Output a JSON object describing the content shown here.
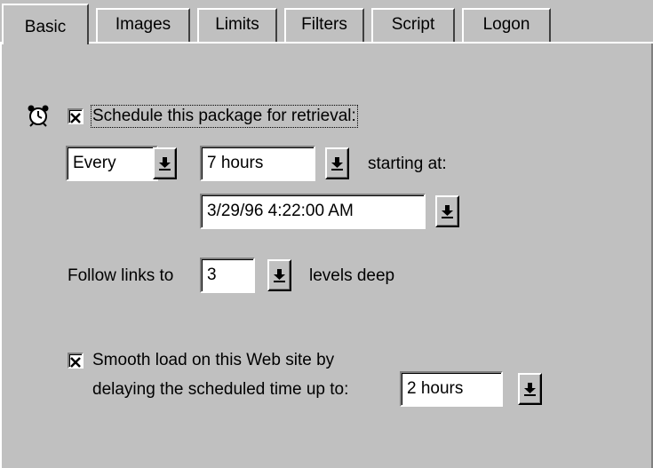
{
  "tabs": [
    {
      "label": "Basic",
      "active": true
    },
    {
      "label": "Images",
      "active": false
    },
    {
      "label": "Limits",
      "active": false
    },
    {
      "label": "Filters",
      "active": false
    },
    {
      "label": "Script",
      "active": false
    },
    {
      "label": "Logon",
      "active": false
    }
  ],
  "schedule": {
    "icon": "alarm-clock-icon",
    "checked": true,
    "label": "Schedule this package for retrieval:",
    "frequency_value": "Every",
    "interval_value": "7 hours",
    "starting_label": "starting at:",
    "start_value": "3/29/96 4:22:00 AM"
  },
  "links": {
    "prefix": "Follow links to",
    "depth_value": "3",
    "suffix": "levels deep"
  },
  "smooth": {
    "checked": true,
    "line1": "Smooth load on this Web site by",
    "line2": "delaying the scheduled time up to:",
    "delay_value": "2 hours"
  }
}
